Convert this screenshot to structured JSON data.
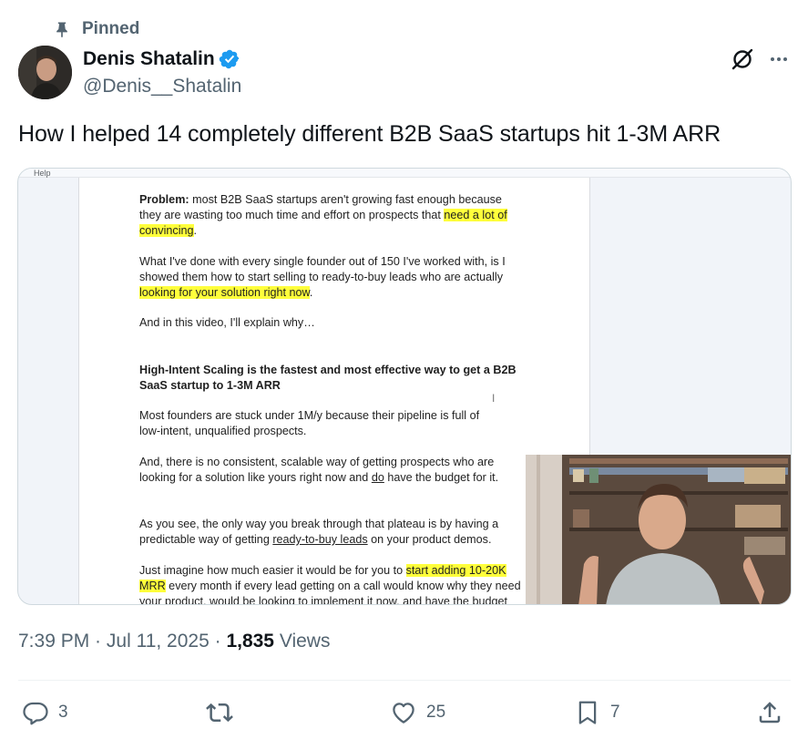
{
  "pinned_label": "Pinned",
  "author": {
    "display_name": "Denis Shatalin",
    "handle": "@Denis__Shatalin",
    "verified": true
  },
  "tweet": {
    "text": "How I helped 14 completely different B2B SaaS startups hit 1-3M ARR"
  },
  "media": {
    "menu_help": "Help",
    "doc": {
      "p1_bold": "Problem:",
      "p1_l1": " most B2B SaaS startups aren't growing fast enough because",
      "p1_l2a": "they are wasting too much time and effort on prospects that ",
      "p1_l2b": "need a lot of",
      "p1_l3": "convincing",
      "p1_l3_end": ".",
      "p2_l1": "What I've done with every single founder out of 150 I've worked with, is I",
      "p2_l2": "showed them how to start selling to ready-to-buy leads who are actually",
      "p2_l3": "looking for your solution right now",
      "p2_l3_end": ".",
      "p3": "And in this video, I'll explain why…",
      "h1_l1": "High-Intent Scaling is the fastest and most effective way to get a B2B",
      "h1_l2": "SaaS startup to 1-3M ARR",
      "p4_l1": "Most founders are stuck under 1M/y because their pipeline is full of",
      "p4_l2": "low-intent, unqualified prospects.",
      "p5_l1": "And, there is no consistent, scalable way of getting prospects who are",
      "p5_l2a": "looking for a solution like yours right now and ",
      "p5_l2b": "do",
      "p5_l2c": " have the budget for it.",
      "p6_l1": "As you see, the only way you break through that plateau is by having a",
      "p6_l2a": "predictable way of getting ",
      "p6_l2b": "ready-to-buy leads",
      "p6_l2c": " on your product demos.",
      "p7_l1a": "Just imagine how much easier it would be for you to ",
      "p7_l1b": "start adding 10-20K",
      "p7_l2a": "MRR",
      "p7_l2b": " every month if every lead getting on a call would know why they need",
      "p7_l3": "your product, would be looking to implement it now, and have the budget"
    }
  },
  "meta": {
    "time": "7:39 PM",
    "sep1": " · ",
    "date": "Jul 11, 2025",
    "sep2": " · ",
    "views_count": "1,835",
    "views_label": " Views"
  },
  "actions": {
    "replies": "3",
    "reposts": "",
    "likes": "25",
    "bookmarks": "7"
  },
  "colors": {
    "text_primary": "#0f1419",
    "text_secondary": "#536471",
    "verified_blue": "#1d9bf0",
    "highlight": "#ffff3b"
  },
  "icons": {
    "pinned": "pin-icon",
    "verified": "verified-badge-icon",
    "grok": "grok-icon",
    "more": "more-icon",
    "reply": "reply-icon",
    "repost": "repost-icon",
    "like": "heart-icon",
    "bookmark": "bookmark-icon",
    "share": "share-icon"
  }
}
